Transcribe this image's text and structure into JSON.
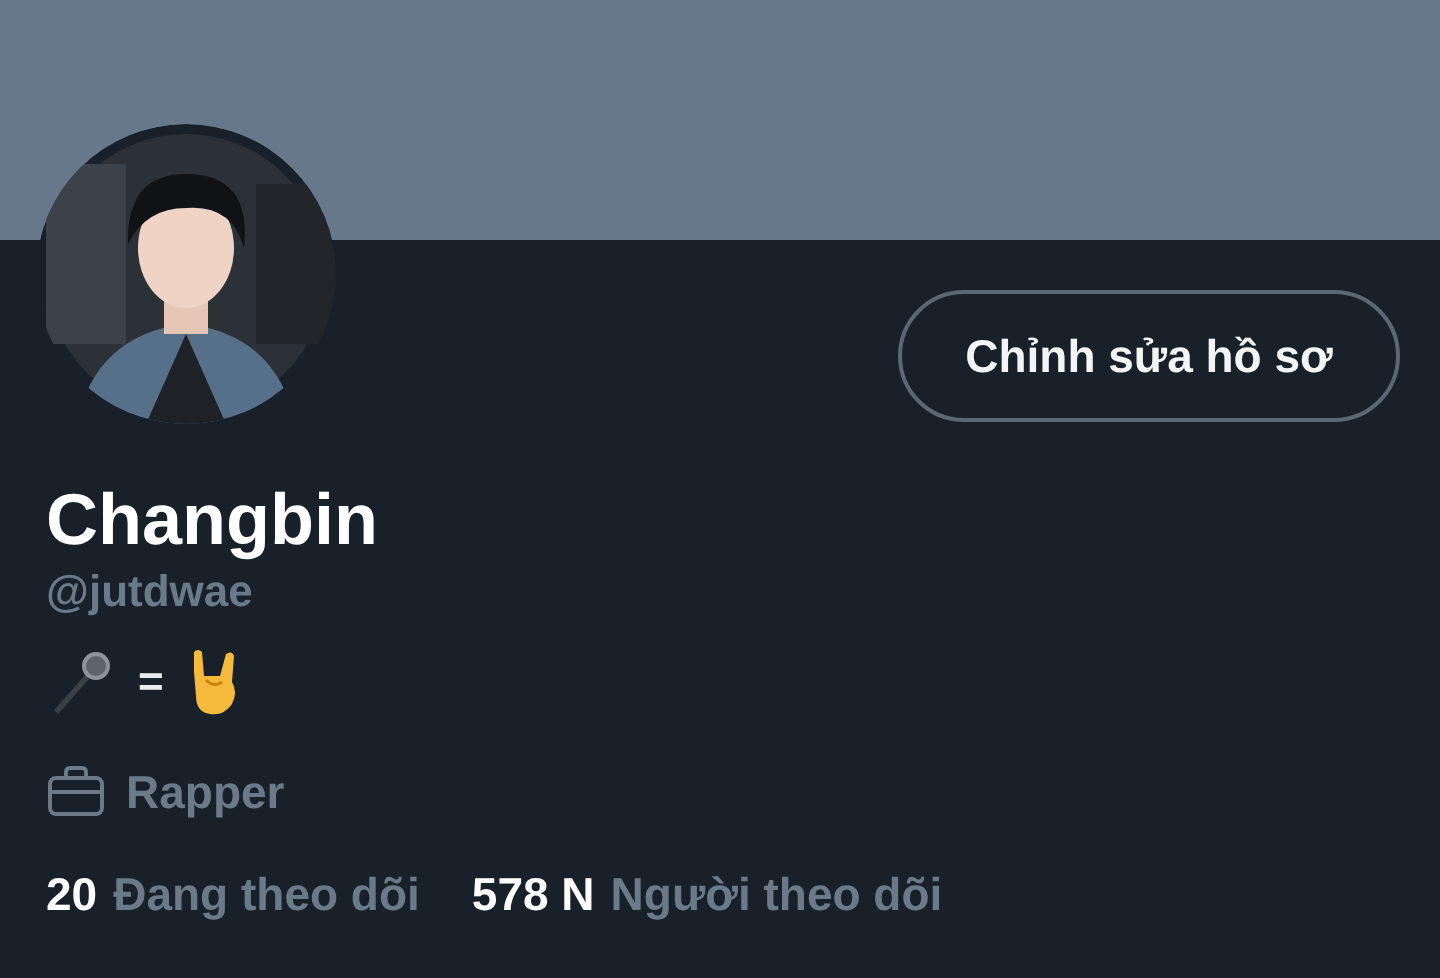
{
  "profile": {
    "edit_button": "Chỉnh sửa hồ sơ",
    "name": "Changbin",
    "handle": "@jutdwae",
    "bio": [
      {
        "kind": "microphone"
      },
      {
        "kind": "text",
        "text": "="
      },
      {
        "kind": "rock-hand"
      }
    ],
    "profession": "Rapper",
    "stats": [
      {
        "count": "20",
        "label": "Đang theo dõi"
      },
      {
        "count": "578 N",
        "label": "Người theo dõi"
      }
    ]
  }
}
